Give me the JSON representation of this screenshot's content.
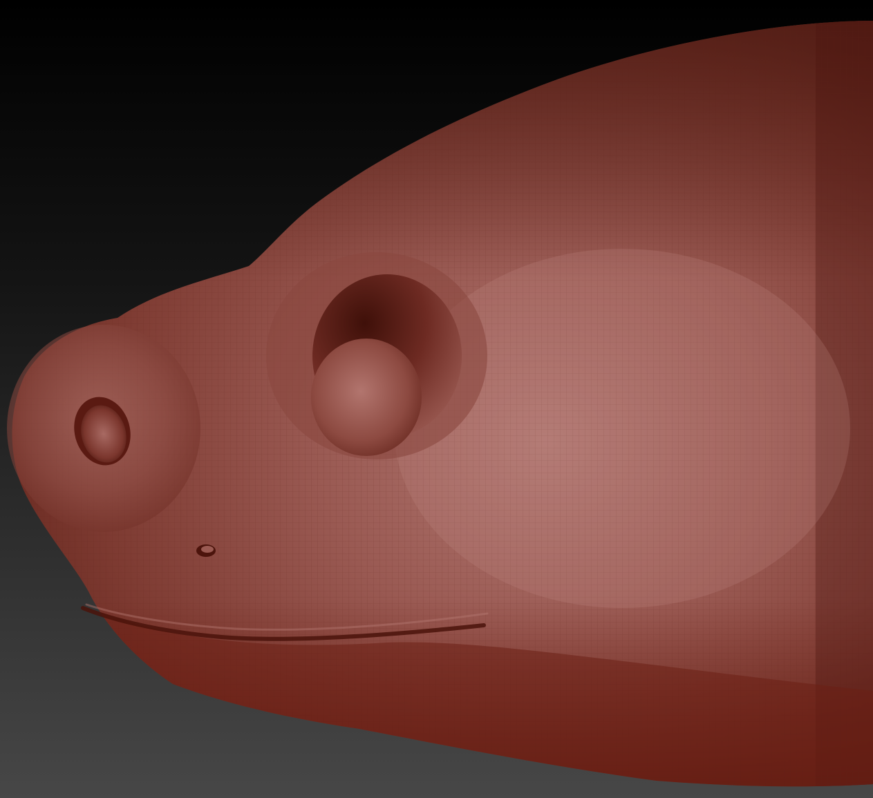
{
  "viewport": {
    "background_top": "#000000",
    "background_bottom": "#474747",
    "model": {
      "description_icon": "sculpt-head-icon",
      "material_base": "#9b4a42",
      "material_highlight": "#c98a84",
      "material_shadow": "#5e1e17",
      "wireframe_color": "#6b2a22"
    }
  }
}
